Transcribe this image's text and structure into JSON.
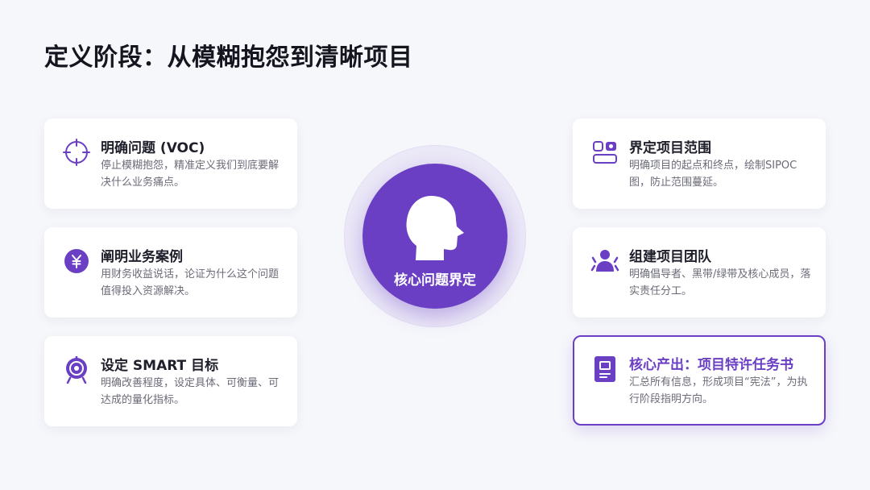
{
  "page": {
    "title": "定义阶段：从模糊抱怨到清晰项目"
  },
  "center": {
    "label": "核心问题界定",
    "icon": "head-icon"
  },
  "colors": {
    "accent": "#6a3fc4",
    "background": "#f6f7fb",
    "card": "#ffffff"
  },
  "cards": [
    {
      "icon": "crosshair-icon",
      "title": "明确问题 (VOC)",
      "desc": "停止模糊抱怨，精准定义我们到底要解决什么业务痛点。"
    },
    {
      "icon": "yen-icon",
      "title": "阐明业务案例",
      "desc": "用财务收益说话，论证为什么这个问题值得投入资源解决。"
    },
    {
      "icon": "target-icon",
      "title": "设定 SMART 目标",
      "desc": "明确改善程度，设定具体、可衡量、可达成的量化指标。"
    },
    {
      "icon": "scope-icon",
      "title": "界定项目范围",
      "desc": "明确项目的起点和终点，绘制SIPOC图，防止范围蔓延。"
    },
    {
      "icon": "team-icon",
      "title": "组建项目团队",
      "desc": "明确倡导者、黑带/绿带及核心成员，落实责任分工。"
    },
    {
      "icon": "charter-icon",
      "title": "核心产出：项目特许任务书",
      "desc": "汇总所有信息，形成项目“宪法”，为执行阶段指明方向。"
    }
  ]
}
